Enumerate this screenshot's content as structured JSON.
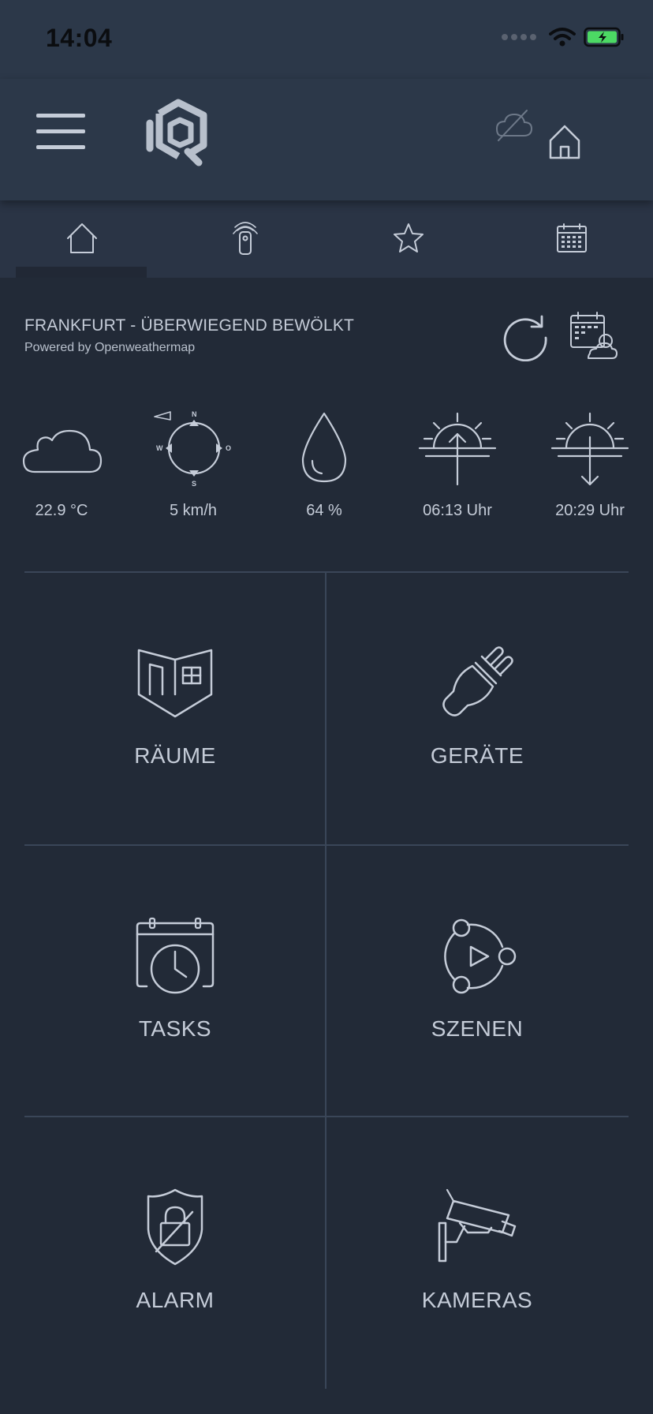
{
  "status_bar": {
    "time": "14:04"
  },
  "header": {
    "menu_icon": "hamburger-menu-icon",
    "logo_icon": "iq-logo",
    "cloud_status_icon": "cloud-off-icon",
    "home_icon": "home-icon"
  },
  "tabs": [
    {
      "icon": "home-icon",
      "active": true
    },
    {
      "icon": "remote-control-icon",
      "active": false
    },
    {
      "icon": "star-icon",
      "active": false
    },
    {
      "icon": "calendar-icon",
      "active": false
    }
  ],
  "weather": {
    "city": "FRANKFURT - ÜBERWIEGEND BEWÖLKT",
    "powered_by": "Powered by Openweathermap",
    "temperature": "22.9 °C",
    "wind": "5 km/h",
    "humidity": "64 %",
    "sunrise": "06:13 Uhr",
    "sunset": "20:29 Uhr",
    "compass": {
      "n": "N",
      "w": "W",
      "o": "O",
      "s": "S"
    }
  },
  "tiles": {
    "rooms": "RÄUME",
    "devices": "GERÄTE",
    "tasks": "TASKS",
    "scenes": "SZENEN",
    "alarm": "ALARM",
    "cameras": "KAMERAS"
  },
  "colors": {
    "background": "#222a37",
    "header": "#2c3849",
    "foreground": "#c5ccd8",
    "battery": "#4cd964"
  }
}
